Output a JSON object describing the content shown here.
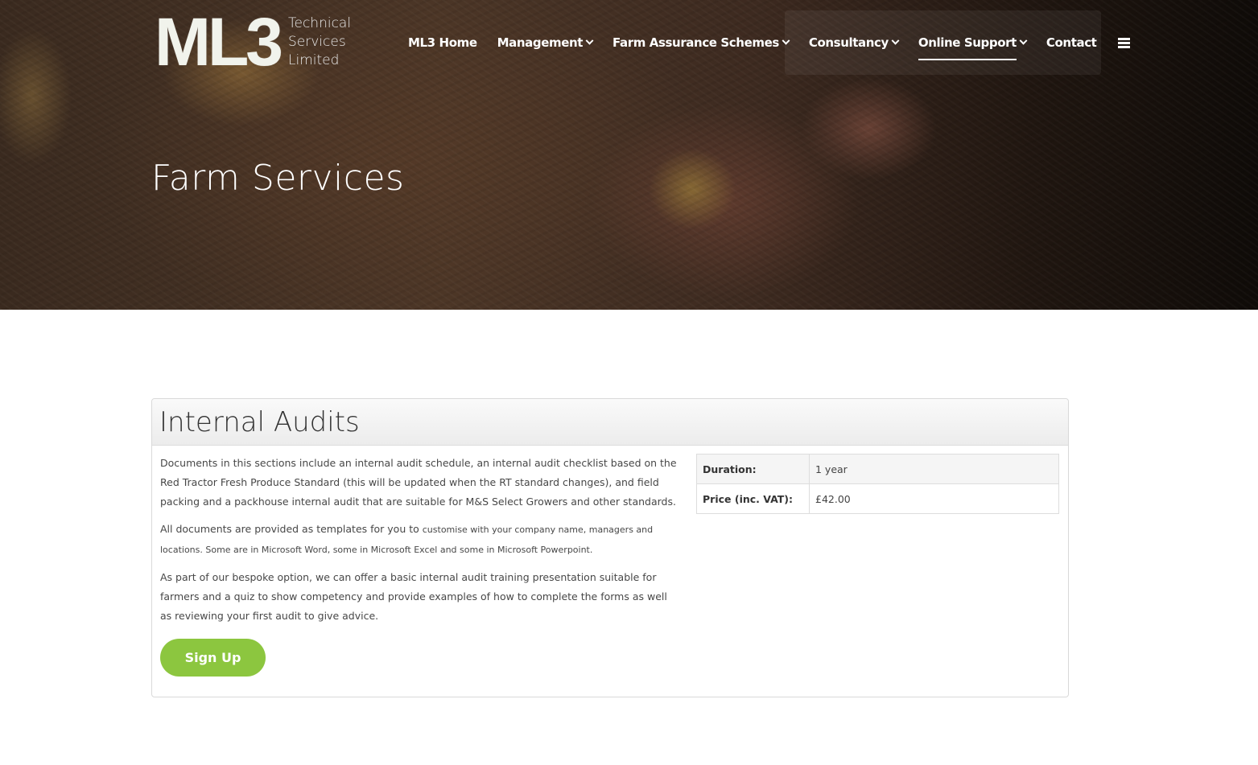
{
  "brand": {
    "logo_mark": "ML3",
    "logo_lines": [
      "Technical",
      "Services",
      "Limited"
    ]
  },
  "nav": {
    "items": [
      {
        "label": "ML3 Home",
        "dropdown": false,
        "active": false
      },
      {
        "label": "Management",
        "dropdown": true,
        "active": false
      },
      {
        "label": "Farm Assurance Schemes",
        "dropdown": true,
        "active": false
      },
      {
        "label": "Consultancy",
        "dropdown": true,
        "active": false
      },
      {
        "label": "Online Support",
        "dropdown": true,
        "active": true
      },
      {
        "label": "Contact",
        "dropdown": false,
        "active": false
      }
    ],
    "menu_icon": "hamburger-icon"
  },
  "hero": {
    "title": "Farm Services"
  },
  "product": {
    "title": "Internal Audits",
    "paragraphs": {
      "p1": "Documents in this sections include an internal audit schedule, an internal audit checklist based on the Red Tractor Fresh Produce Standard (this will be updated when the RT standard changes), and field packing and a packhouse internal audit that are suitable for M&S Select Growers and other standards.",
      "p2_lead": "All documents are provided as templates for you to ",
      "p2_small": "customise with your company name, managers and locations. Some are in Microsoft Word, some in Microsoft Excel and some in Microsoft Powerpoint.",
      "p3": "As part of our bespoke option, we can offer a basic internal audit training presentation suitable for farmers and a quiz to show competency and provide examples of how to complete the forms as well as reviewing your first audit to give advice."
    },
    "details": {
      "duration_label": "Duration:",
      "duration_value": "1 year",
      "price_label": "Price (inc. VAT):",
      "price_value": "£42.00"
    },
    "signup_label": "Sign Up"
  },
  "colors": {
    "accent": "#8cc63f",
    "nav_text": "#ffffff"
  }
}
